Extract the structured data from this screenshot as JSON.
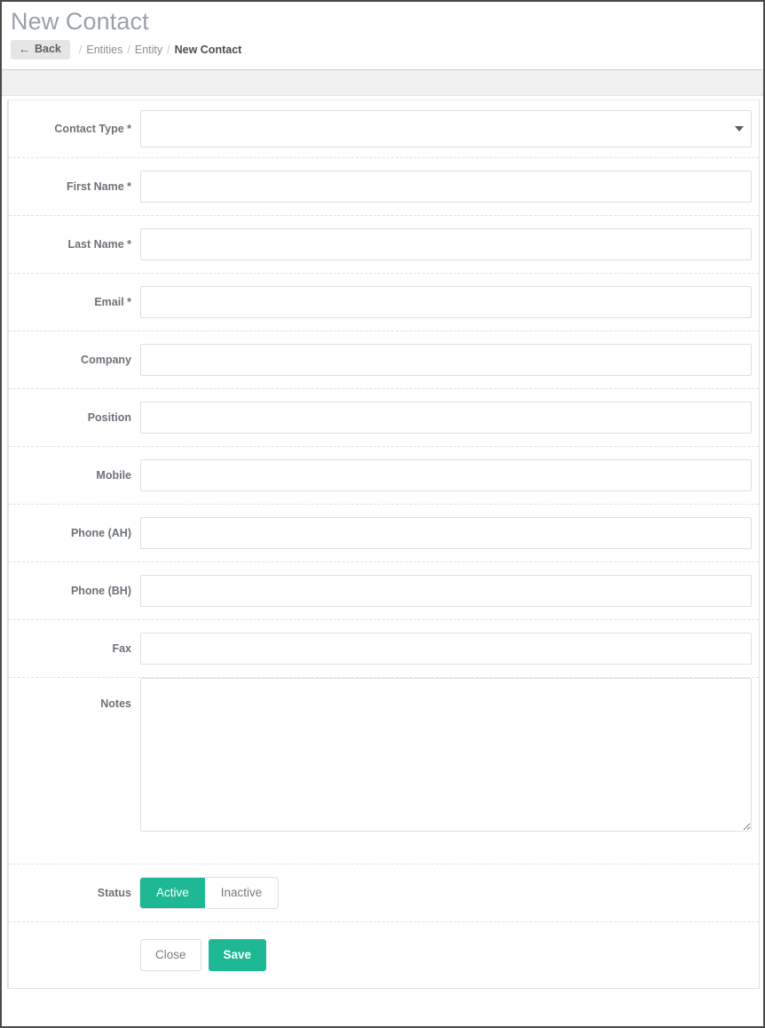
{
  "header": {
    "title": "New Contact",
    "back_label": "Back",
    "back_icon": "arrow-left-icon",
    "breadcrumb": {
      "separator": "/",
      "items": [
        {
          "label": "Entities",
          "current": false
        },
        {
          "label": "Entity",
          "current": false
        },
        {
          "label": "New Contact",
          "current": true
        }
      ]
    }
  },
  "form": {
    "fields": [
      {
        "label": "Contact Type *",
        "type": "select",
        "value": "",
        "placeholder": ""
      },
      {
        "label": "First Name *",
        "type": "text",
        "value": "",
        "placeholder": ""
      },
      {
        "label": "Last Name *",
        "type": "text",
        "value": "",
        "placeholder": ""
      },
      {
        "label": "Email *",
        "type": "text",
        "value": "",
        "placeholder": ""
      },
      {
        "label": "Company",
        "type": "text",
        "value": "",
        "placeholder": ""
      },
      {
        "label": "Position",
        "type": "text",
        "value": "",
        "placeholder": ""
      },
      {
        "label": "Mobile",
        "type": "text",
        "value": "",
        "placeholder": ""
      },
      {
        "label": "Phone (AH)",
        "type": "text",
        "value": "",
        "placeholder": ""
      },
      {
        "label": "Phone (BH)",
        "type": "text",
        "value": "",
        "placeholder": ""
      },
      {
        "label": "Fax",
        "type": "text",
        "value": "",
        "placeholder": ""
      },
      {
        "label": "Notes",
        "type": "textarea",
        "value": "",
        "placeholder": ""
      }
    ],
    "status": {
      "label": "Status",
      "options": [
        {
          "label": "Active",
          "selected": true
        },
        {
          "label": "Inactive",
          "selected": false
        }
      ]
    },
    "actions": {
      "close_label": "Close",
      "save_label": "Save"
    }
  },
  "colors": {
    "accent_green": "#1fb894",
    "label_gray": "#6d7278",
    "title_gray": "#9aa1a9",
    "band_gray": "#f0f0f0",
    "border_gray": "#e0e0e0"
  }
}
